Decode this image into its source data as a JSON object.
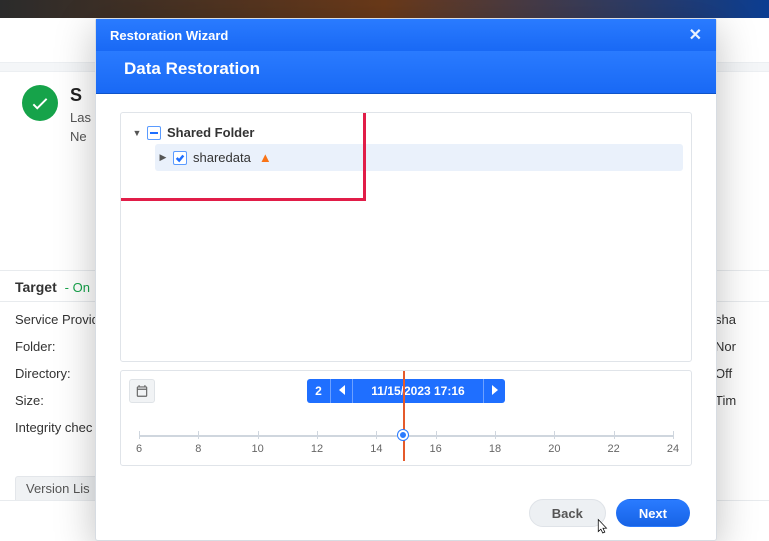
{
  "background": {
    "status_title": "S",
    "status_line1": "Las",
    "status_line2": "Ne",
    "target_label": "Target",
    "target_status": "- On",
    "fields": [
      "Service Provid",
      "Folder:",
      "Directory:",
      "Size:",
      "Integrity chec"
    ],
    "fields_right": [
      "sha",
      "Nor",
      "Off",
      "Tim"
    ],
    "version_tab": "Version Lis"
  },
  "modal": {
    "header_title": "Restoration Wizard",
    "title": "Data Restoration",
    "tree": {
      "root_label": "Shared Folder",
      "child_label": "sharedata"
    },
    "timeline": {
      "count": "2",
      "date_label": "11/15/2023 17:16",
      "ticks": [
        "6",
        "8",
        "10",
        "12",
        "14",
        "16",
        "18",
        "20",
        "22",
        "24"
      ],
      "marker_hour": 14.9
    },
    "buttons": {
      "back": "Back",
      "next": "Next"
    }
  }
}
